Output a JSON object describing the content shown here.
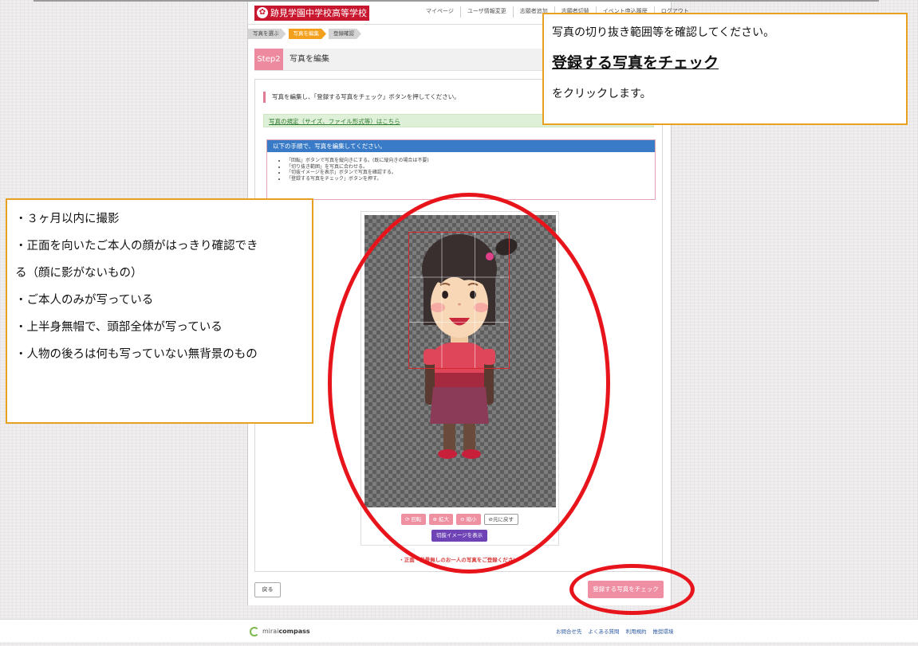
{
  "header": {
    "school_name": "跡見学園中学校高等学校",
    "school_mark": "✿",
    "nav": [
      "マイページ",
      "ユーザ情報変更",
      "志願者追加",
      "志願者切替",
      "イベント申込履歴",
      "ログアウト"
    ]
  },
  "steps": {
    "items": [
      "写真を選ぶ",
      "写真を編集",
      "登録確認"
    ],
    "active_index": 1
  },
  "step_header": {
    "badge": "Step2",
    "title": "写真を編集"
  },
  "content": {
    "instruction": "写真を編集し、「登録する写真をチェック」ボタンを押してください。",
    "rules_link": "写真の規定（サイズ、ファイル形式等）はこちら",
    "panel_title": "以下の手順で、写真を編集してください。",
    "panel_items": [
      "「回転」ボタンで写真を縦向きにする。(既に縦向きの場合は不要)",
      "「切り抜き範囲」を写真に合わせる。",
      "「切抜イメージを表示」ボタンで写真を確認する。",
      "「登録する写真をチェック」ボタンを押す。"
    ],
    "tools": {
      "rotate": "回転",
      "zoom_in": "拡大",
      "zoom_out": "縮小",
      "reset": "元に戻す"
    },
    "preview_button": "切抜イメージを表示",
    "warning": "・正面・背景無しのお一人の写真をご登録ください"
  },
  "actions": {
    "back": "戻る",
    "submit": "登録する写真をチェック"
  },
  "footer": {
    "brand_light": "mirai",
    "brand_bold": "compass",
    "links": [
      "お問合せ先",
      "よくある質問",
      "利用規約",
      "推奨環境"
    ]
  },
  "callout_right": {
    "line1": "写真の切り抜き範囲等を確認してください。",
    "line2": "登録する写真をチェック",
    "line3": "をクリックします。"
  },
  "callout_left": {
    "lines": [
      "・３ヶ月以内に撮影",
      "・正面を向いたご本人の顔がはっきり確認でき",
      "る（顔に影がないもの）",
      "・ご本人のみが写っている",
      "・上半身無帽で、頭部全体が写っている",
      "・人物の後ろは何も写っていない無背景のもの"
    ]
  },
  "colors": {
    "brand_red": "#c9172f",
    "accent_pink": "#ee8aa0",
    "step_active": "#f3a01c",
    "panel_blue": "#3a7bc8",
    "preview_purple": "#6e43b5",
    "annotation_red": "#e8141b",
    "callout_border": "#e8a020"
  }
}
